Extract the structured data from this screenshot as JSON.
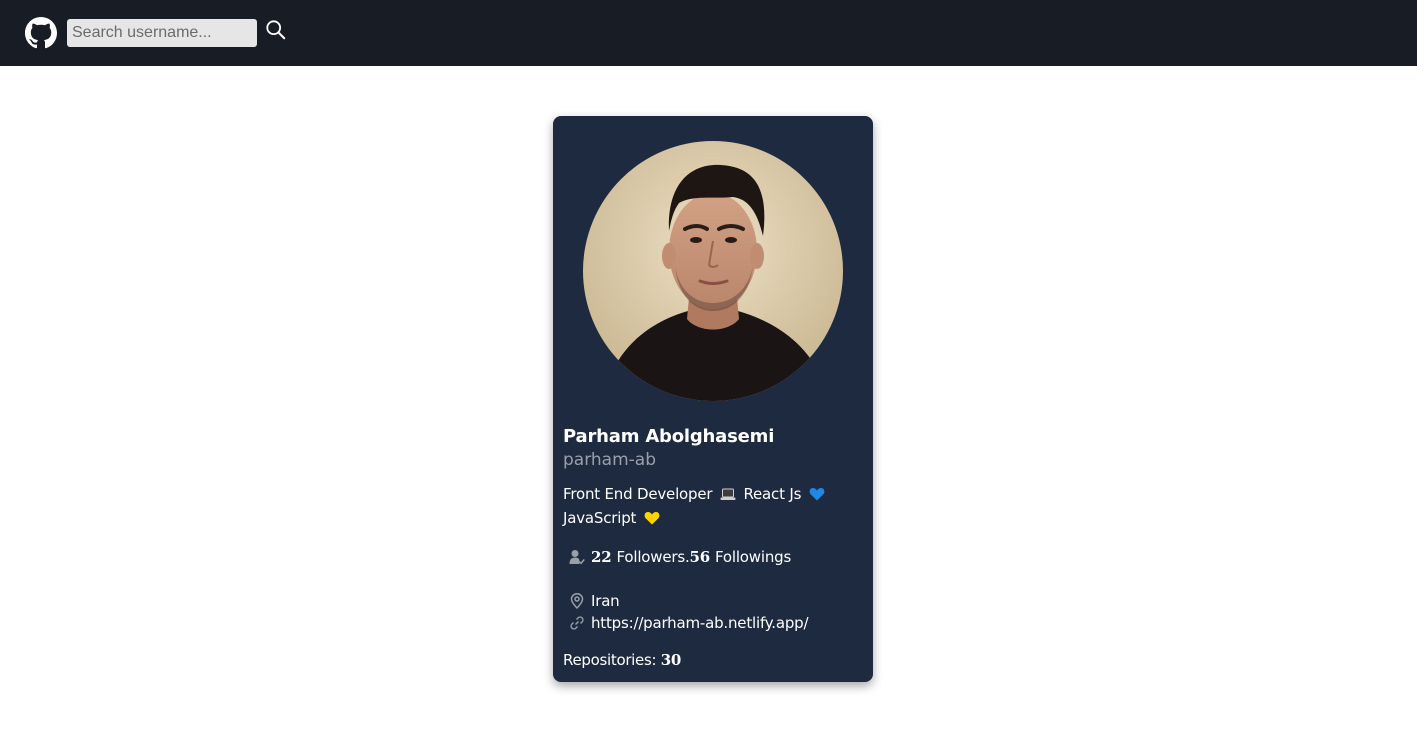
{
  "header": {
    "search_placeholder": "Search username...",
    "background": "#181c25"
  },
  "icons": {
    "logo": "github-icon",
    "search": "search-icon",
    "followers": "user-check-icon",
    "location": "map-pin-icon",
    "blog": "link-icon",
    "laptop": "laptop-emoji",
    "blue_heart": "blue-heart-emoji",
    "yellow_heart": "yellow-heart-emoji"
  },
  "profile": {
    "name": "Parham Abolghasemi",
    "login": "parham-ab",
    "bio_part1": "Front End Developer",
    "bio_part2": "React Js",
    "bio_part3": "JavaScript",
    "followers_count": "22",
    "followers_label": "Followers.",
    "following_count": "56",
    "following_label": "Followings",
    "location": "Iran",
    "blog": "https://parham-ab.netlify.app/",
    "repos_label": "Repositories:",
    "repos_count": "30"
  },
  "colors": {
    "card_bg": "#1e2a40",
    "muted_text": "#9aa0aa",
    "blue_heart": "#1e88e5",
    "yellow_heart": "#ffd400"
  }
}
